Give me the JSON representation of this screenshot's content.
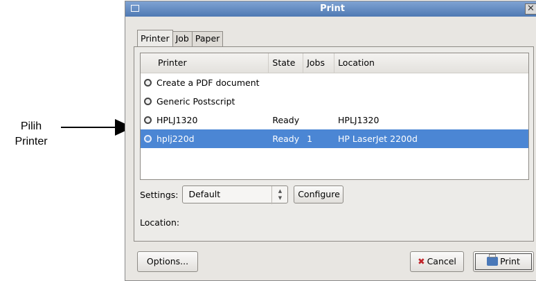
{
  "annotation": {
    "line1": "Pilih",
    "line2": "Printer"
  },
  "window": {
    "title": "Print",
    "close_glyph": "✕"
  },
  "tabs": [
    {
      "label": "Printer"
    },
    {
      "label": "Job"
    },
    {
      "label": "Paper"
    }
  ],
  "printer_list": {
    "columns": [
      "Printer",
      "State",
      "Jobs",
      "Location"
    ],
    "rows": [
      {
        "name": "Create a PDF document",
        "state": "",
        "jobs": "",
        "location": ""
      },
      {
        "name": "Generic Postscript",
        "state": "",
        "jobs": "",
        "location": ""
      },
      {
        "name": "HPLJ1320",
        "state": "Ready",
        "jobs": "",
        "location": "HPLJ1320"
      },
      {
        "name": "hplj220d",
        "state": "Ready",
        "jobs": "1",
        "location": "HP LaserJet 2200d"
      }
    ],
    "selected_index": 3,
    "icon": "printer-icon"
  },
  "settings": {
    "label": "Settings:",
    "value": "Default",
    "configure_label": "Configure"
  },
  "location_label": "Location:",
  "buttons": {
    "options": "Options...",
    "cancel": "Cancel",
    "print": "Print"
  },
  "colors": {
    "titlebar": "#5a82bb",
    "selection": "#4b86d4",
    "cancel_icon": "#c0242a"
  }
}
